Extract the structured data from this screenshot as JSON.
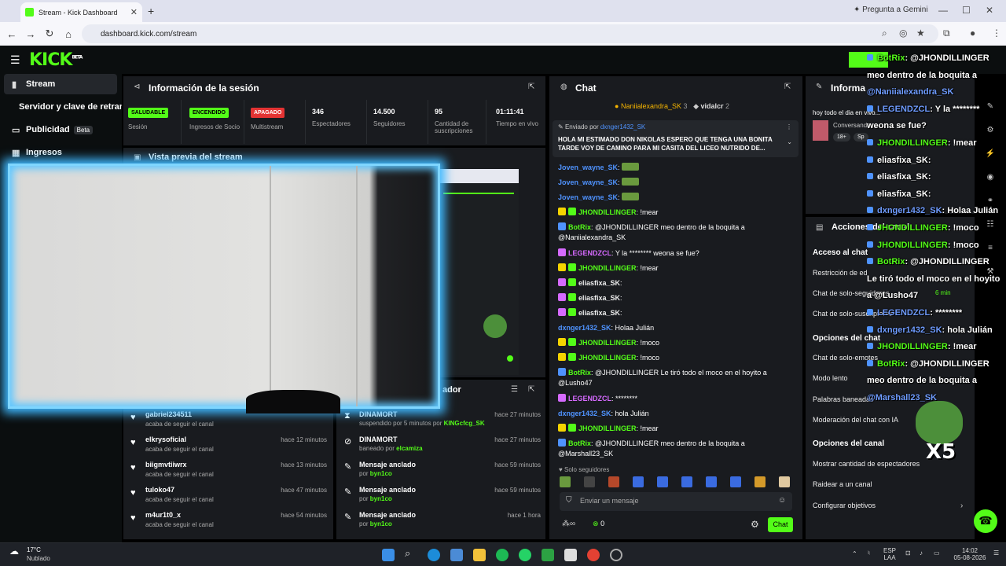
{
  "browser": {
    "tab_title": "Stream - Kick Dashboard",
    "new_tab": "+",
    "gemini": "Pregunta a Gemini",
    "url": "dashboard.kick.com/stream"
  },
  "kick": {
    "logo": "KICK",
    "logo_sup": "BETA"
  },
  "sidebar": {
    "items": [
      {
        "label": "Stream",
        "icon": "stream-icon"
      },
      {
        "label": "Servidor y clave de retransmisión",
        "icon": ""
      },
      {
        "label": "Publicidad",
        "icon": "megaphone-icon",
        "badge": "Beta"
      },
      {
        "label": "Ingresos",
        "icon": "chart-icon"
      }
    ]
  },
  "session": {
    "title": "Información de la sesión",
    "stats": [
      {
        "pill": "SALUDABLE",
        "pill_color": "#53fc18",
        "label": "Sesión"
      },
      {
        "pill": "ENCENDIDO",
        "pill_color": "#53fc18",
        "label": "Ingresos de Socio"
      },
      {
        "pill": "APAGADO",
        "pill_color": "#e33333",
        "label": "Multistream"
      },
      {
        "value": "346",
        "label": "Espectadores"
      },
      {
        "value": "14.500",
        "label": "Seguidores"
      },
      {
        "value": "95",
        "label": "Cantidad de suscripciones"
      },
      {
        "value": "01:11:41",
        "label": "Tiempo en vivo"
      }
    ]
  },
  "preview": {
    "title": "Vista previa del stream"
  },
  "activity": [
    {
      "name": "gabriel234511",
      "sub": "acaba de seguir el canal",
      "time": ""
    },
    {
      "name": "elkrysoficial",
      "sub": "acaba de seguir el canal",
      "time": "hace 12 minutos"
    },
    {
      "name": "biigmvtiiwrx",
      "sub": "acaba de seguir el canal",
      "time": "hace 13 minutos"
    },
    {
      "name": "tuloko47",
      "sub": "acaba de seguir el canal",
      "time": "hace 47 minutos"
    },
    {
      "name": "m4ur1t0_x",
      "sub": "acaba de seguir el canal",
      "time": "hace 54 minutos"
    }
  ],
  "moderator": {
    "title": "ador",
    "rows": [
      {
        "name": "DINAMORT",
        "sub_pre": "suspendido por 5 minutos por ",
        "sub_by": "KINGcfcg_SK",
        "time": "hace 27 minutos",
        "icon": "hourglass-icon"
      },
      {
        "name": "DINAMORT",
        "sub_pre": "baneado por ",
        "sub_by": "elcamiza",
        "time": "hace 27 minutos",
        "icon": "ban-icon"
      },
      {
        "name": "Mensaje anclado",
        "sub_pre": "por ",
        "sub_by": "byn1co",
        "time": "hace 59 minutos",
        "icon": "pin-icon"
      },
      {
        "name": "Mensaje anclado",
        "sub_pre": "por ",
        "sub_by": "byn1co",
        "time": "hace 59 minutos",
        "icon": "pin-icon"
      },
      {
        "name": "Mensaje anclado",
        "sub_pre": "por ",
        "sub_by": "byn1co",
        "time": "hace 1 hora",
        "icon": "pin-icon"
      }
    ]
  },
  "chat": {
    "title": "Chat",
    "gifter1": "Naniialexandra_SK",
    "gifter1_count": "3",
    "gifter2": "vidalcr",
    "gifter2_count": "2",
    "pinned_label": "Enviado por ",
    "pinned_by": "dxnger1432_SK",
    "pinned_text": "HOLA MI ESTIMADO DON NIKOLAS ESPERO QUE TENGA UNA BONITA TARDE VOY DE CAMINO PARA MI CASITA DEL LICEO NUTRIDO DE...",
    "messages": [
      {
        "user": "Joven_wayne_SK",
        "cls": "u-blue",
        "text": ":"
      },
      {
        "user": "Joven_wayne_SK",
        "cls": "u-blue",
        "text": ":"
      },
      {
        "user": "Joven_wayne_SK",
        "cls": "u-blue",
        "text": ":"
      },
      {
        "user": "JHONDILLINGER",
        "cls": "u-green",
        "text": ": !mear"
      },
      {
        "user": "BotRix",
        "cls": "u-green",
        "text": ": @JHONDILLINGER meo dentro de la boquita a @Naniialexandra_SK"
      },
      {
        "user": "LEGENDZCL",
        "cls": "u-purple",
        "text": ": Y la ******** weona se fue?"
      },
      {
        "user": "JHONDILLINGER",
        "cls": "u-green",
        "text": ": !mear"
      },
      {
        "user": "eliasfixa_SK",
        "cls": "u-white",
        "text": ":"
      },
      {
        "user": "eliasfixa_SK",
        "cls": "u-white",
        "text": ":"
      },
      {
        "user": "eliasfixa_SK",
        "cls": "u-white",
        "text": ":"
      },
      {
        "user": "dxnger1432_SK",
        "cls": "u-blue",
        "text": ": Holaa Julián"
      },
      {
        "user": "JHONDILLINGER",
        "cls": "u-green",
        "text": ": !moco"
      },
      {
        "user": "JHONDILLINGER",
        "cls": "u-green",
        "text": ": !moco"
      },
      {
        "user": "BotRix",
        "cls": "u-green",
        "text": ": @JHONDILLINGER Le tiró todo el moco en el hoyito a @Lusho47"
      },
      {
        "user": "LEGENDZCL",
        "cls": "u-purple",
        "text": ": ********"
      },
      {
        "user": "dxnger1432_SK",
        "cls": "u-blue",
        "text": ": hola Julián"
      },
      {
        "user": "JHONDILLINGER",
        "cls": "u-green",
        "text": ": !mear"
      },
      {
        "user": "BotRix",
        "cls": "u-green",
        "text": ": @JHONDILLINGER meo dentro de la boquita a @Marshall23_SK"
      }
    ],
    "followers_only": "Solo seguidores",
    "input_placeholder": "Enviar un mensaje",
    "count": "0",
    "send": "Chat"
  },
  "right_panel": {
    "info_title": "Informa",
    "stream_title": "hoy todo el dia en vivo...",
    "stream_title2": "Conversando",
    "tag1": "18+",
    "tag2": "Sp",
    "actions_title": "Acciones del canal",
    "chat_access": "Acceso al chat",
    "rows1": [
      "Restricción de ed",
      "Chat de solo-seguidores",
      "Chat de solo-suscriptores"
    ],
    "chat_options": "Opciones del chat",
    "rows2": [
      "Chat de solo-emotes",
      "Modo lento",
      "Palabras baneadas",
      "Moderación del chat con IA"
    ],
    "channel_options": "Opciones del canal",
    "rows3": [
      "Mostrar cantidad de espectadores",
      "Raidear a un canal",
      "Configurar objetivos"
    ],
    "slow_time": "6 min"
  },
  "overlay": [
    {
      "pre": "",
      "name": "BotRix",
      "post": ": @JHONDILLINGER",
      "cls": "g"
    },
    {
      "pre": "",
      "name": "",
      "post": "meo dentro de la boquita a",
      "cls": "w"
    },
    {
      "pre": "",
      "name": "",
      "post": "@Naniialexandra_SK",
      "cls": "b"
    },
    {
      "pre": "",
      "name": "LEGENDZCL",
      "post": ": Y la ********",
      "cls": "b"
    },
    {
      "pre": "",
      "name": "",
      "post": "weona se fue?",
      "cls": "w"
    },
    {
      "pre": "",
      "name": "JHONDILLINGER",
      "post": ": !mear",
      "cls": "g"
    },
    {
      "pre": "",
      "name": "eliasfixa_SK",
      "post": ":",
      "cls": "w"
    },
    {
      "pre": "",
      "name": "eliasfixa_SK",
      "post": ":",
      "cls": "w"
    },
    {
      "pre": "",
      "name": "eliasfixa_SK",
      "post": ":",
      "cls": "w"
    },
    {
      "pre": "",
      "name": "dxnger1432_SK",
      "post": ": Holaa Julián",
      "cls": "b"
    },
    {
      "pre": "",
      "name": "JHONDILLINGER",
      "post": ": !moco",
      "cls": "g"
    },
    {
      "pre": "",
      "name": "JHONDILLINGER",
      "post": ": !moco",
      "cls": "g"
    },
    {
      "pre": "",
      "name": "BotRix",
      "post": ": @JHONDILLINGER",
      "cls": "g"
    },
    {
      "pre": "",
      "name": "",
      "post": "Le tiró todo el moco en el hoyito",
      "cls": "w"
    },
    {
      "pre": "",
      "name": "",
      "post": "a @Lusho47",
      "cls": "w"
    },
    {
      "pre": "",
      "name": "LEGENDZCL",
      "post": ": ********",
      "cls": "b"
    },
    {
      "pre": "",
      "name": "dxnger1432_SK",
      "post": ": hola Julián",
      "cls": "b"
    },
    {
      "pre": "",
      "name": "JHONDILLINGER",
      "post": ": !mear",
      "cls": "g"
    },
    {
      "pre": "",
      "name": "BotRix",
      "post": ": @JHONDILLINGER",
      "cls": "g"
    },
    {
      "pre": "",
      "name": "",
      "post": "meo dentro de la boquita a",
      "cls": "w"
    },
    {
      "pre": "",
      "name": "",
      "post": "@Marshall23_SK",
      "cls": "b"
    }
  ],
  "taskbar": {
    "temp": "17°C",
    "weather": "Nublado",
    "lang1": "ESP",
    "lang2": "LAA",
    "time": "14:02",
    "date": "05-08-2026"
  },
  "colors": {
    "kick_green": "#53fc18",
    "panel": "#191b1f",
    "glow": "#3fb9ff"
  }
}
